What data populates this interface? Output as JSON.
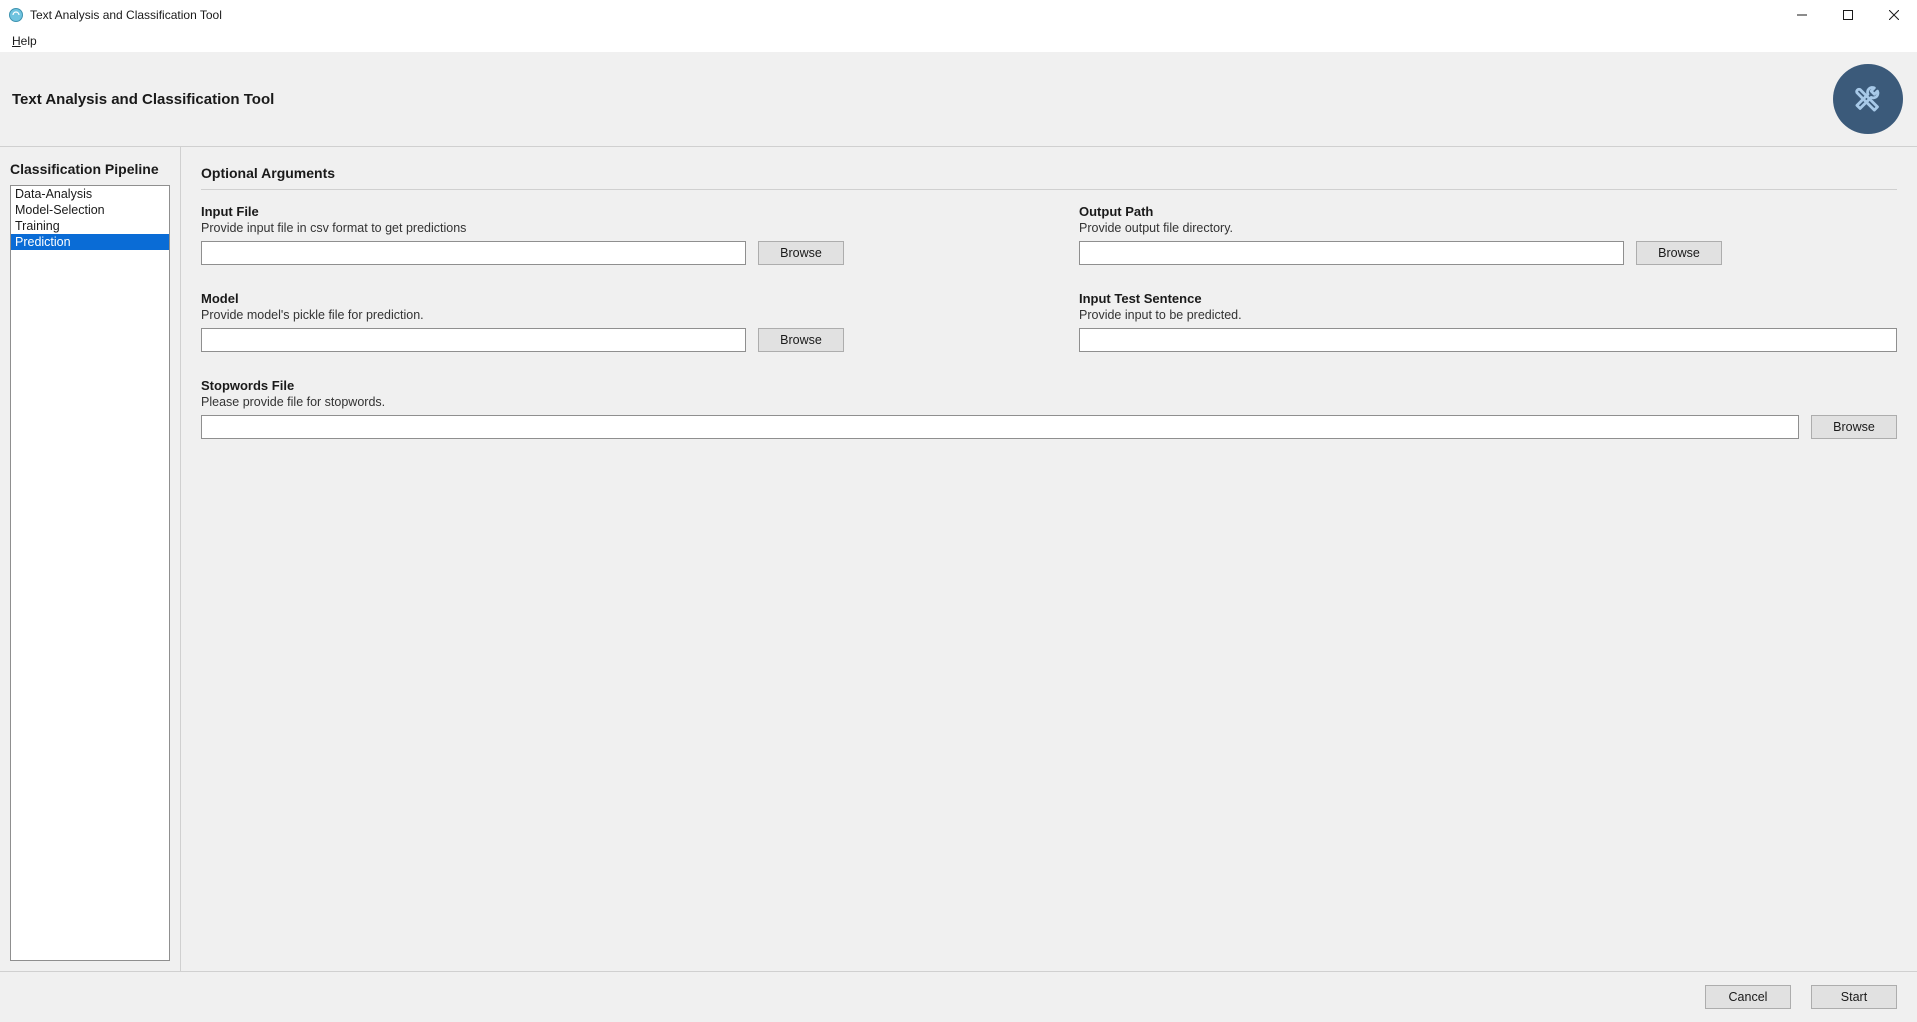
{
  "titlebar": {
    "title": "Text Analysis and Classification Tool"
  },
  "menubar": {
    "help": "Help",
    "help_underline": "H",
    "help_rest": "elp"
  },
  "header": {
    "title": "Text Analysis and Classification Tool"
  },
  "sidebar": {
    "title": "Classification Pipeline",
    "items": [
      {
        "label": "Data-Analysis",
        "selected": false
      },
      {
        "label": "Model-Selection",
        "selected": false
      },
      {
        "label": "Training",
        "selected": false
      },
      {
        "label": "Prediction",
        "selected": true
      }
    ]
  },
  "content": {
    "section_title": "Optional Arguments",
    "fields": {
      "input_file": {
        "label": "Input File",
        "desc": "Provide input file in csv format to get predictions",
        "value": "",
        "browse": "Browse"
      },
      "output_path": {
        "label": "Output Path",
        "desc": "Provide output file directory.",
        "value": "",
        "browse": "Browse"
      },
      "model": {
        "label": "Model",
        "desc": "Provide model's pickle file for prediction.",
        "value": "",
        "browse": "Browse"
      },
      "input_test_sentence": {
        "label": "Input Test Sentence",
        "desc": "Provide input to be predicted.",
        "value": ""
      },
      "stopwords_file": {
        "label": "Stopwords File",
        "desc": "Please provide file for stopwords.",
        "value": "",
        "browse": "Browse"
      }
    }
  },
  "footer": {
    "cancel": "Cancel",
    "start": "Start"
  }
}
